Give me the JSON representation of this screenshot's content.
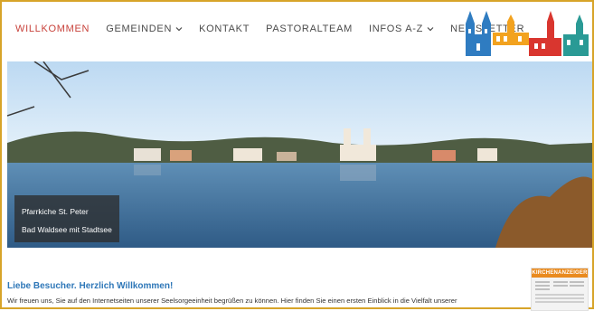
{
  "nav": {
    "items": [
      {
        "label": "WILLKOMMEN",
        "active": true,
        "dropdown": false
      },
      {
        "label": "GEMEINDEN",
        "active": false,
        "dropdown": true
      },
      {
        "label": "KONTAKT",
        "active": false,
        "dropdown": false
      },
      {
        "label": "PASTORALTEAM",
        "active": false,
        "dropdown": false
      },
      {
        "label": "INFOS A-Z",
        "active": false,
        "dropdown": true
      },
      {
        "label": "NEWSLETTER",
        "active": false,
        "dropdown": false
      }
    ],
    "active_color": "#c8423b",
    "text_color": "#4b4b4b"
  },
  "hero": {
    "caption_line1": "Pfarrkiche St. Peter",
    "caption_line2": "Bad Waldsee mit Stadtsee"
  },
  "welcome": {
    "title": "Liebe Besucher. Herzlich Willkommen!",
    "text": "Wir freuen uns, Sie auf den Internetseiten unserer Seelsorgeeinheit begrüßen zu können. Hier finden Sie einen ersten Einblick in die Vielfalt unserer"
  },
  "sidebar": {
    "kirchenanzeiger_label": "KIRCHENANZEIGER"
  },
  "colors": {
    "frame": "#d7a429",
    "title_blue": "#2e77b8"
  }
}
